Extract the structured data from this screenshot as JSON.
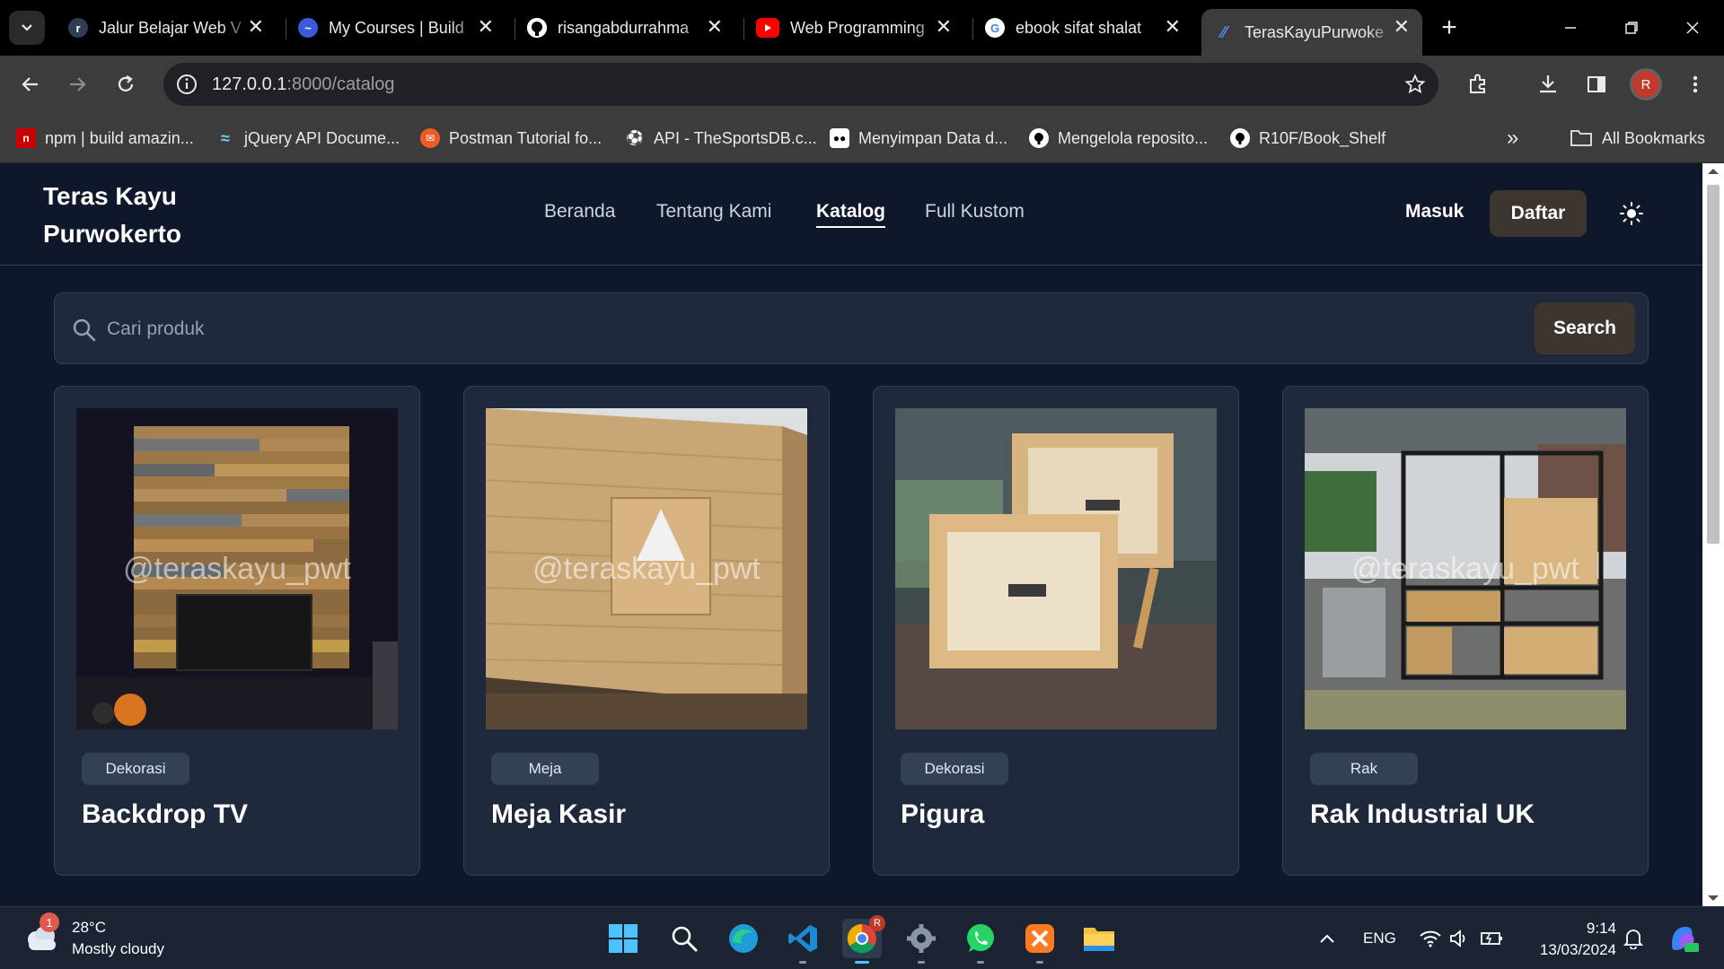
{
  "browser": {
    "tabs": [
      {
        "title": "Jalur Belajar Web V",
        "icon": "dicoding-icon",
        "color": "#2d3e50"
      },
      {
        "title": "My Courses | Build",
        "icon": "course-icon",
        "color": "#3b5bdb"
      },
      {
        "title": "risangabdurrahma",
        "icon": "github-icon",
        "color": "#000000"
      },
      {
        "title": "Web Programming",
        "icon": "youtube-icon",
        "color": "#ff0000"
      },
      {
        "title": "ebook sifat shalat",
        "icon": "google-icon",
        "color": "#ffffff"
      },
      {
        "title": "TerasKayuPurwoke",
        "icon": "page-icon",
        "color": "#4c8bf5"
      }
    ],
    "url_host": "127.0.0.1",
    "url_path": ":8000/catalog",
    "profile_initial": "R",
    "bookmarks": [
      {
        "label": "npm | build amazin...",
        "icon": "npm-icon",
        "color": "#cb0000"
      },
      {
        "label": "jQuery API Docume...",
        "icon": "jquery-icon",
        "color": "#0769ad"
      },
      {
        "label": "Postman Tutorial fo...",
        "icon": "postman-icon",
        "color": "#ef5b25"
      },
      {
        "label": "API - TheSportsDB.c...",
        "icon": "sportsdb-icon",
        "color": "#777777"
      },
      {
        "label": "Menyimpan Data d...",
        "icon": "medium-icon",
        "color": "#000000"
      },
      {
        "label": "Mengelola reposito...",
        "icon": "github-icon",
        "color": "#000000"
      },
      {
        "label": "R10F/Book_Shelf",
        "icon": "github-icon",
        "color": "#000000"
      }
    ],
    "overflow_label": "»",
    "all_bookmarks": "All Bookmarks"
  },
  "site": {
    "brand_line1": "Teras Kayu",
    "brand_line2": "Purwokerto",
    "nav": [
      "Beranda",
      "Tentang Kami",
      "Katalog",
      "Full Kustom"
    ],
    "active_nav": "Katalog",
    "login": "Masuk",
    "register": "Daftar",
    "search_placeholder": "Cari produk",
    "search_button": "Search",
    "watermark": "@teraskayu_pwt",
    "products": [
      {
        "category": "Dekorasi",
        "name": "Backdrop TV"
      },
      {
        "category": "Meja",
        "name": "Meja Kasir"
      },
      {
        "category": "Dekorasi",
        "name": "Pigura"
      },
      {
        "category": "Rak",
        "name": "Rak Industrial UK"
      }
    ]
  },
  "taskbar": {
    "weather_badge": "1",
    "temperature": "28°C",
    "condition": "Mostly cloudy",
    "language": "ENG",
    "time": "9:14",
    "date": "13/03/2024",
    "chrome_badge": "R"
  },
  "colors": {
    "page_bg": "#0f172a",
    "card_bg": "#1e293b",
    "button_bg": "#3d3530"
  }
}
